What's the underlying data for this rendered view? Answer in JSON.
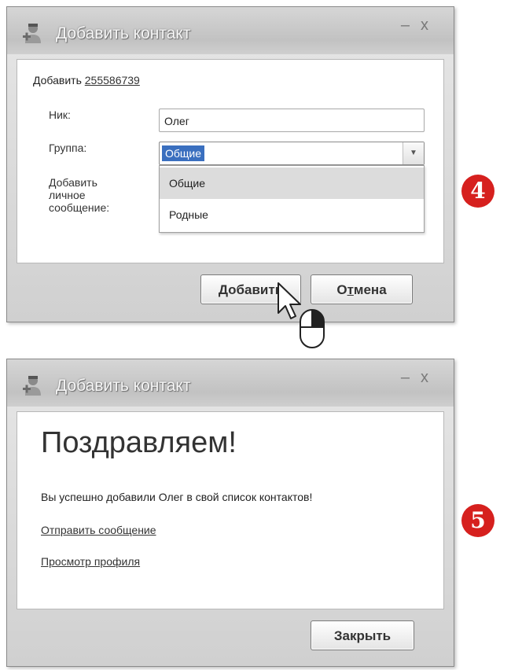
{
  "dialog1": {
    "title": "Добавить контакт",
    "minimize": "–",
    "close": "x",
    "add_prefix": "Добавить",
    "add_number": "255586739",
    "nick_label": "Ник:",
    "nick_value": "Олег",
    "group_label": "Группа:",
    "group_value": "Общие",
    "message_label_1": "Добавить",
    "message_label_2": "личное",
    "message_label_3": "сообщение:",
    "dropdown_options": [
      "Общие",
      "Родные"
    ],
    "add_button": "Добавить",
    "cancel_button_first": "О",
    "cancel_button_underlined": "т",
    "cancel_button_rest": "мена"
  },
  "dialog2": {
    "title": "Добавить контакт",
    "minimize": "–",
    "close": "x",
    "heading": "Поздравляем!",
    "message": "Вы успешно добавили Олег в свой список контактов!",
    "send_message_link": "Отправить сообщение",
    "view_profile_link": "Просмотр профиля",
    "close_button": "Закрыть"
  },
  "step_badges": [
    "4",
    "5"
  ],
  "colors": {
    "badge": "#d6201e",
    "selection": "#3a6fbf",
    "highlight": "#dcdcdc"
  },
  "icons": [
    "contact-add-icon",
    "mouse-cursor-icon",
    "mouse-icon"
  ]
}
